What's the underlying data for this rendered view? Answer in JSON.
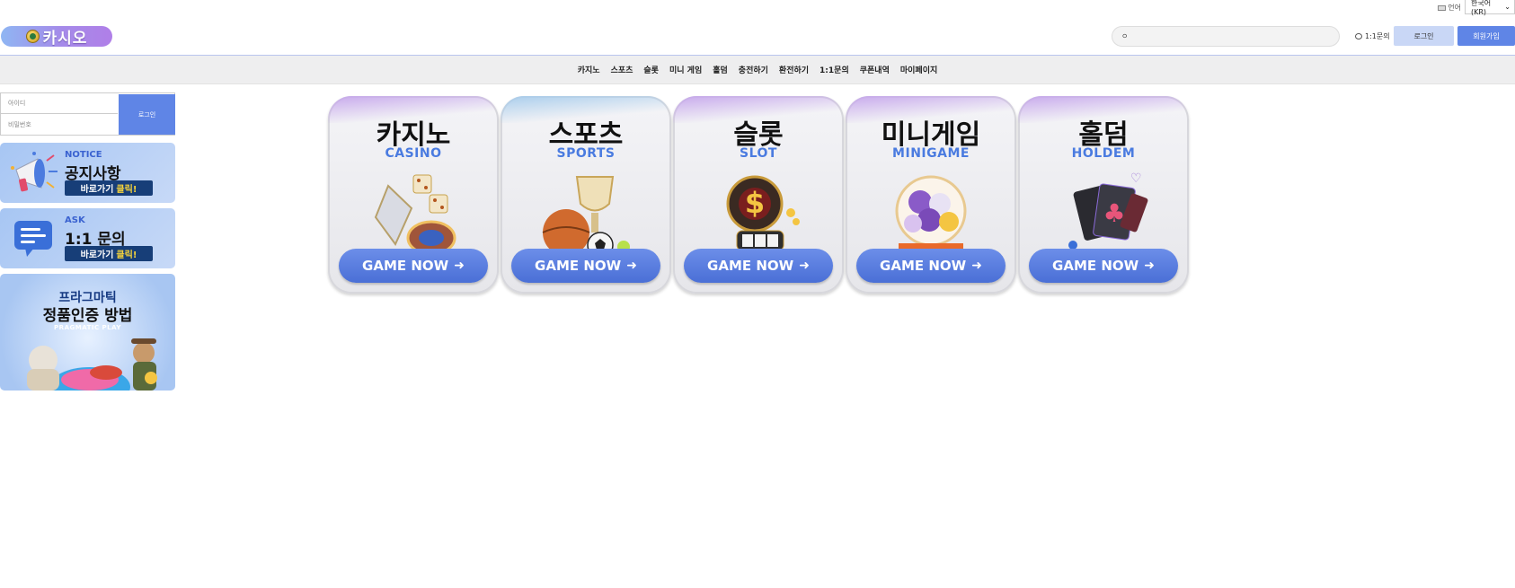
{
  "topbar": {
    "lang_label": "언어",
    "lang_value": "한국어 (KR)"
  },
  "header": {
    "logo_text": "카시오",
    "search_value": "ㅇ",
    "qna_label": "1:1문의",
    "login_label": "로그인",
    "join_label": "회원가입"
  },
  "nav": {
    "items": [
      "카지노",
      "스포츠",
      "슬롯",
      "미니 게임",
      "홀덤",
      "충전하기",
      "환전하기",
      "1:1문의",
      "쿠폰내역",
      "마이페이지"
    ]
  },
  "login_box": {
    "id_placeholder": "아이디",
    "pw_placeholder": "비밀번호",
    "submit_label": "로그인"
  },
  "banners": {
    "notice": {
      "tag": "NOTICE",
      "title": "공지사항",
      "go": "바로가기",
      "go_hl": "클릭!"
    },
    "ask": {
      "tag": "ASK",
      "title": "1:1 문의",
      "go": "바로가기",
      "go_hl": "클릭!"
    },
    "pragmatic": {
      "line1": "프라그마틱",
      "line2": "정품인증 방법",
      "line3": "PRAGMATIC PLAY"
    }
  },
  "games": [
    {
      "kr": "카지노",
      "en": "CASINO",
      "button": "GAME NOW",
      "icon": "casino-dice-icon"
    },
    {
      "kr": "스포츠",
      "en": "SPORTS",
      "button": "GAME NOW",
      "icon": "sports-trophy-icon"
    },
    {
      "kr": "슬롯",
      "en": "SLOT",
      "button": "GAME NOW",
      "icon": "slot-machine-icon"
    },
    {
      "kr": "미니게임",
      "en": "MINIGAME",
      "button": "GAME NOW",
      "icon": "minigame-balls-icon"
    },
    {
      "kr": "홀덤",
      "en": "HOLDEM",
      "button": "GAME NOW",
      "icon": "holdem-cards-icon"
    }
  ],
  "colors": {
    "accent": "#5f85e6",
    "accent_light": "#c9d7f6",
    "nav_bg": "#eeeeef",
    "en_label": "#4a7be0",
    "go_button": "#173e78"
  }
}
